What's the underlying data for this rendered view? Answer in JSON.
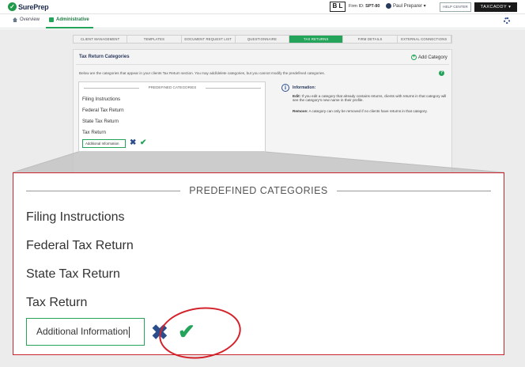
{
  "header": {
    "logo_text": "SurePrep",
    "logo_mark": "✓",
    "firm_badge": "B L",
    "firm_id_label": "Firm ID:",
    "firm_id_value": "SPT-80",
    "user_name": "Paul Preparer ▾",
    "help_label": "HELP CENTER",
    "taxcaddy_label": "TAXCADDY ▾"
  },
  "nav": {
    "overview": "Overview",
    "administrative": "Administrative"
  },
  "tabs": [
    {
      "label": "Client Management",
      "active": false
    },
    {
      "label": "Templates",
      "active": false
    },
    {
      "label": "Document Request List",
      "active": false
    },
    {
      "label": "Questionnaire",
      "active": false
    },
    {
      "label": "Tax Returns",
      "active": true
    },
    {
      "label": "Firm Details",
      "active": false
    },
    {
      "label": "External Connections",
      "active": false
    }
  ],
  "section": {
    "title": "Tax Return Categories",
    "add_label": "Add Category",
    "description": "Below are the categories that appear in your clients Tax Return section. You may add/delete categories, but you cannot modify the predefined categories.",
    "help": "?"
  },
  "categories": {
    "heading": "PREDEFINED CATEGORIES",
    "items": [
      "Filing Instructions",
      "Federal Tax Return",
      "State Tax Return",
      "Tax Return"
    ],
    "input_value": "Additional Information",
    "cancel_glyph": "✖",
    "confirm_glyph": "✔"
  },
  "info": {
    "icon": "i",
    "title": "Information:",
    "edit_label": "Edit:",
    "edit_text": "If you edit a category that already contains returns, clients with returns in that category will see the category's new name in their profile.",
    "remove_label": "Remove:",
    "remove_text": "A category can only be removed if no clients have returns in that category."
  },
  "colors": {
    "accent_green": "#24a35a",
    "navy": "#2b4d8c",
    "highlight_red": "#d4222b"
  }
}
